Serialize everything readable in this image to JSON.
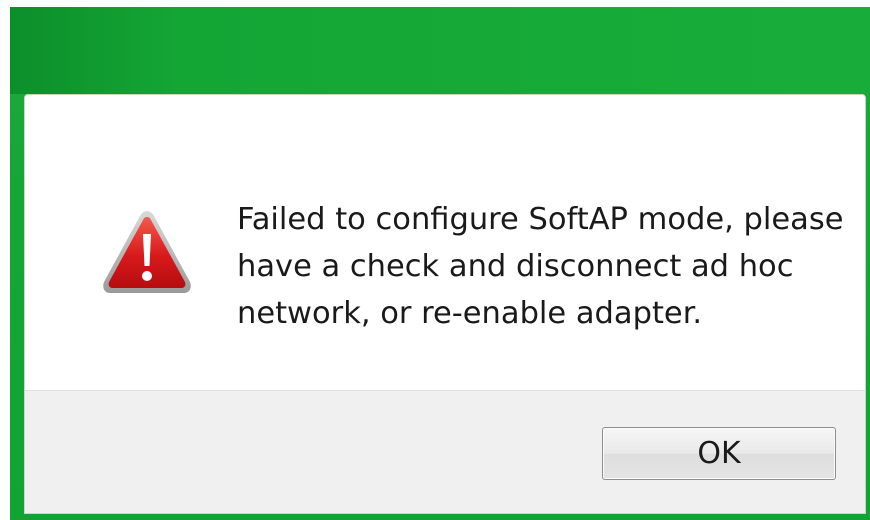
{
  "dialog": {
    "message": "Failed to configure SoftAP mode, please\nhave a check and disconnect ad hoc\nnetwork, or re-enable adapter.",
    "icon": "warning-icon",
    "ok_label": "OK"
  },
  "colors": {
    "frame_green": "#15a636",
    "warning_red": "#d8191b",
    "footer_gray": "#f0f0f0"
  }
}
